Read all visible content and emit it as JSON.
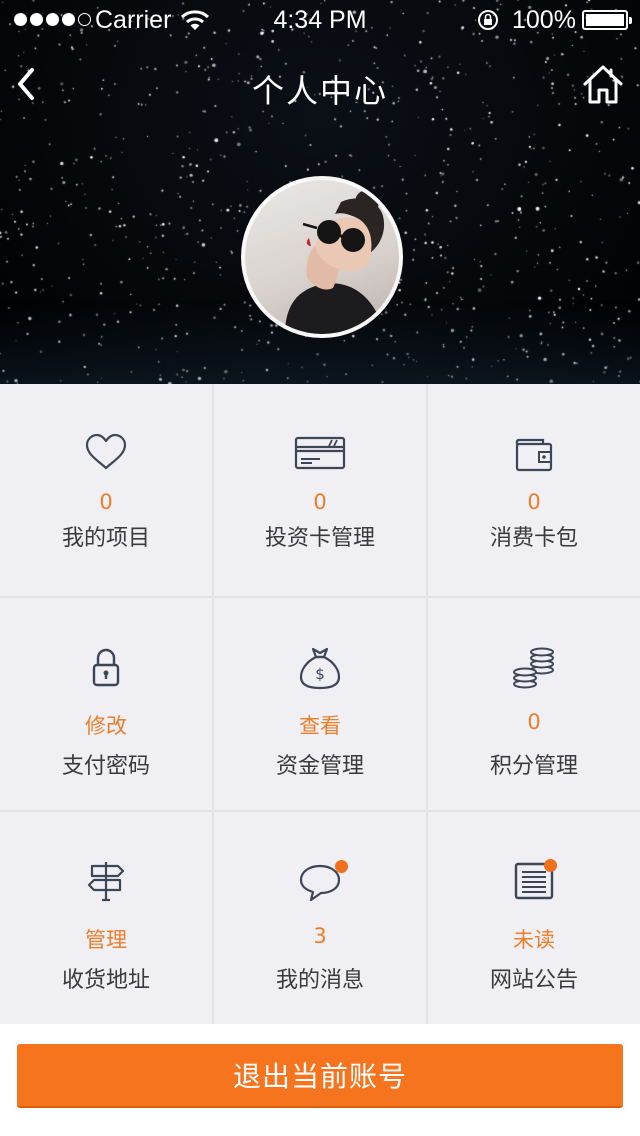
{
  "status_bar": {
    "carrier": "Carrier",
    "time": "4:34 PM",
    "battery": "100%"
  },
  "nav": {
    "title": "个人中心",
    "back_icon": "chevron-left-icon",
    "home_icon": "home-icon"
  },
  "grid": [
    {
      "icon": "heart-icon",
      "value": "0",
      "label": "我的项目"
    },
    {
      "icon": "credit-card-icon",
      "value": "0",
      "label": "投资卡管理"
    },
    {
      "icon": "wallet-icon",
      "value": "0",
      "label": "消费卡包"
    },
    {
      "icon": "lock-icon",
      "value": "修改",
      "label": "支付密码"
    },
    {
      "icon": "money-bag-icon",
      "value": "查看",
      "label": "资金管理"
    },
    {
      "icon": "coins-icon",
      "value": "0",
      "label": "积分管理"
    },
    {
      "icon": "signpost-icon",
      "value": "管理",
      "label": "收货地址"
    },
    {
      "icon": "chat-bubble-icon",
      "value": "3",
      "label": "我的消息"
    },
    {
      "icon": "announcement-list-icon",
      "value": "未读",
      "label": "网站公告"
    }
  ],
  "logout_label": "退出当前账号",
  "colors": {
    "accent": "#f7741f",
    "accent_text": "#ee7d29",
    "grid_bg": "#efeff4",
    "icon_stroke": "#3d4656"
  }
}
